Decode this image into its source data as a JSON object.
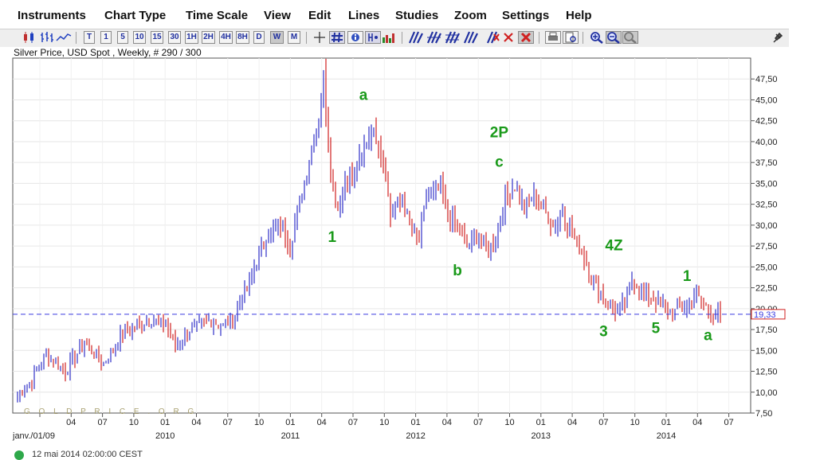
{
  "menu": [
    "Instruments",
    "Chart Type",
    "Time Scale",
    "View",
    "Edit",
    "Lines",
    "Studies",
    "Zoom",
    "Settings",
    "Help"
  ],
  "toolbar": {
    "timeframes": [
      "T",
      "1",
      "5",
      "10",
      "15",
      "30",
      "1H",
      "2H",
      "4H",
      "8H",
      "D",
      "W",
      "M"
    ],
    "selected_timeframe": "W",
    "tool_icons": [
      "candlestick-icon",
      "bar-chart-icon",
      "line-chart-icon",
      "crosshair-icon",
      "grid-icon",
      "info-icon",
      "mouse-info-icon",
      "volume-icon",
      "trend-line-icon",
      "fibonacci-icon",
      "channel-icon",
      "parallel-lines-icon",
      "delete-line-icon",
      "close-icon",
      "delete-all-icon",
      "print-icon",
      "print-preview-icon",
      "zoom-in-icon",
      "zoom-out-icon",
      "zoom-reset-icon",
      "pin-icon"
    ]
  },
  "chart_title": "Silver Price, USD Spot , Weekly, # 290 / 300",
  "status_text": "12 mai 2014 02:00:00 CEST",
  "chart_data": {
    "type": "bar",
    "style": "ohlc",
    "title": "Silver Price, USD Spot , Weekly, # 290 / 300",
    "ylim": [
      7.5,
      50.0
    ],
    "y_ticks": [
      "7,50",
      "10,00",
      "12,50",
      "15,00",
      "17,50",
      "20,00",
      "22,50",
      "25,00",
      "27,50",
      "30,00",
      "32,50",
      "35,00",
      "37,50",
      "40,00",
      "42,50",
      "45,00",
      "47,50"
    ],
    "x_month_labels": [
      "janv./01/09",
      "04",
      "07",
      "10",
      "01",
      "04",
      "07",
      "10",
      "01",
      "04",
      "07",
      "10",
      "01",
      "04",
      "07",
      "10",
      "01",
      "04",
      "07",
      "10",
      "01",
      "04",
      "07"
    ],
    "x_year_labels": [
      "2010",
      "2011",
      "2012",
      "2013",
      "2014"
    ],
    "current_price_line": 19.33,
    "current_price_label": "19,33",
    "grid": true,
    "watermark": "G O L D P R I C E . O R G",
    "up_color": "#3030c8",
    "down_color": "#d02020",
    "annotation_color": "#1a9a1a",
    "annotations": [
      {
        "text": "1",
        "date": "2011-05",
        "price": 28.0
      },
      {
        "text": "a",
        "date": "2011-08",
        "price": 45.0
      },
      {
        "text": "2P",
        "date": "2012-09",
        "price": 40.5
      },
      {
        "text": "c",
        "date": "2012-09",
        "price": 37.0
      },
      {
        "text": "b",
        "date": "2012-05",
        "price": 24.0
      },
      {
        "text": "4Z",
        "date": "2013-08",
        "price": 27.0
      },
      {
        "text": "3",
        "date": "2013-07",
        "price": 16.7
      },
      {
        "text": "5",
        "date": "2013-12",
        "price": 17.1
      },
      {
        "text": "1",
        "date": "2014-03",
        "price": 23.3
      },
      {
        "text": "a",
        "date": "2014-05",
        "price": 16.2
      }
    ],
    "anchors": [
      {
        "w": 0,
        "p": 9.5
      },
      {
        "w": 6,
        "p": 11.5
      },
      {
        "w": 12,
        "p": 14.5
      },
      {
        "w": 20,
        "p": 12.5
      },
      {
        "w": 28,
        "p": 16.0
      },
      {
        "w": 36,
        "p": 13.5
      },
      {
        "w": 44,
        "p": 17.0
      },
      {
        "w": 50,
        "p": 18.0
      },
      {
        "w": 56,
        "p": 18.8
      },
      {
        "w": 62,
        "p": 18.0
      },
      {
        "w": 66,
        "p": 15.5
      },
      {
        "w": 72,
        "p": 17.5
      },
      {
        "w": 80,
        "p": 18.5
      },
      {
        "w": 86,
        "p": 18.0
      },
      {
        "w": 90,
        "p": 18.8
      },
      {
        "w": 96,
        "p": 22.5
      },
      {
        "w": 104,
        "p": 28.5
      },
      {
        "w": 110,
        "p": 30.0
      },
      {
        "w": 114,
        "p": 27.5
      },
      {
        "w": 120,
        "p": 35.0
      },
      {
        "w": 126,
        "p": 43.0
      },
      {
        "w": 128,
        "p": 48.0
      },
      {
        "w": 131,
        "p": 36.0
      },
      {
        "w": 134,
        "p": 32.0
      },
      {
        "w": 137,
        "p": 35.5
      },
      {
        "w": 141,
        "p": 36.0
      },
      {
        "w": 145,
        "p": 39.0
      },
      {
        "w": 148,
        "p": 41.5
      },
      {
        "w": 151,
        "p": 40.0
      },
      {
        "w": 154,
        "p": 36.0
      },
      {
        "w": 156,
        "p": 31.0
      },
      {
        "w": 158,
        "p": 32.5
      },
      {
        "w": 161,
        "p": 33.0
      },
      {
        "w": 165,
        "p": 29.0
      },
      {
        "w": 168,
        "p": 28.5
      },
      {
        "w": 171,
        "p": 33.0
      },
      {
        "w": 174,
        "p": 34.0
      },
      {
        "w": 177,
        "p": 34.5
      },
      {
        "w": 180,
        "p": 31.5
      },
      {
        "w": 184,
        "p": 30.0
      },
      {
        "w": 188,
        "p": 27.5
      },
      {
        "w": 192,
        "p": 28.5
      },
      {
        "w": 196,
        "p": 27.0
      },
      {
        "w": 200,
        "p": 28.0
      },
      {
        "w": 204,
        "p": 33.5
      },
      {
        "w": 208,
        "p": 34.5
      },
      {
        "w": 212,
        "p": 32.0
      },
      {
        "w": 216,
        "p": 33.5
      },
      {
        "w": 220,
        "p": 32.0
      },
      {
        "w": 224,
        "p": 30.0
      },
      {
        "w": 228,
        "p": 31.5
      },
      {
        "w": 232,
        "p": 29.0
      },
      {
        "w": 236,
        "p": 27.0
      },
      {
        "w": 240,
        "p": 23.5
      },
      {
        "w": 244,
        "p": 22.0
      },
      {
        "w": 248,
        "p": 20.0
      },
      {
        "w": 250,
        "p": 19.8
      },
      {
        "w": 254,
        "p": 20.5
      },
      {
        "w": 257,
        "p": 23.5
      },
      {
        "w": 260,
        "p": 22.5
      },
      {
        "w": 263,
        "p": 21.5
      },
      {
        "w": 267,
        "p": 21.0
      },
      {
        "w": 270,
        "p": 20.5
      },
      {
        "w": 274,
        "p": 19.5
      },
      {
        "w": 277,
        "p": 20.0
      },
      {
        "w": 280,
        "p": 20.2
      },
      {
        "w": 283,
        "p": 21.5
      },
      {
        "w": 286,
        "p": 21.0
      },
      {
        "w": 289,
        "p": 19.8
      },
      {
        "w": 292,
        "p": 19.3
      },
      {
        "w": 294,
        "p": 19.33
      }
    ]
  }
}
